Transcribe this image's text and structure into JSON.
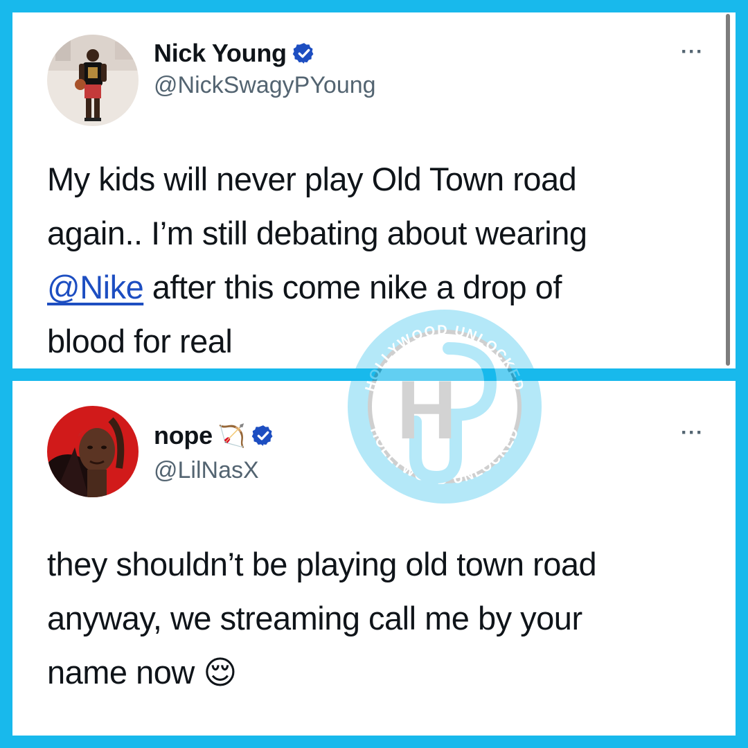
{
  "tweets": [
    {
      "display_name": "Nick Young",
      "handle": "@NickSwagyPYoung",
      "verified": true,
      "more_label": "···",
      "text_lines": [
        {
          "before": "My kids will never play Old Town road",
          "mention": "",
          "after": ""
        },
        {
          "before": "again.. I’m still debating about wearing",
          "mention": "",
          "after": ""
        },
        {
          "before": "",
          "mention": "@Nike",
          "after": " after this come nike a drop of"
        },
        {
          "before": "blood for real",
          "mention": "",
          "after": ""
        }
      ]
    },
    {
      "display_name": "nope",
      "name_emoji": "🏹",
      "handle": "@LilNasX",
      "verified": true,
      "more_label": "···",
      "text_lines": [
        {
          "before": "they shouldn’t be playing old town road",
          "emoji": ""
        },
        {
          "before": "anyway, we streaming call me by your",
          "emoji": ""
        },
        {
          "before": "name now ",
          "emoji": "😌"
        }
      ]
    }
  ],
  "watermark": {
    "ring_text_top": "HOLLYWOOD UNLOCKED",
    "ring_text_bottom": "HOLLYWOOD UNLOCKED",
    "monogram": "H"
  },
  "colors": {
    "frame": "#18b9ec",
    "verified": "#1d4ec1",
    "mention": "#1d4ec1",
    "handle": "#536471"
  }
}
